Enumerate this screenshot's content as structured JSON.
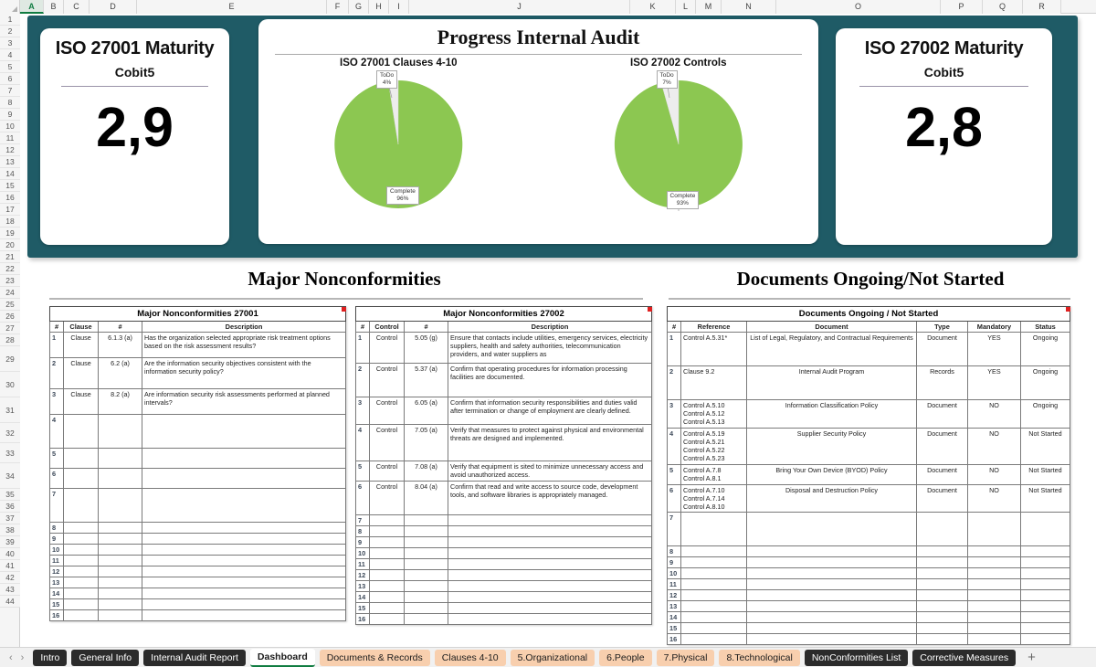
{
  "app": {
    "column_headers": [
      "A",
      "B",
      "C",
      "D",
      "E",
      "F",
      "G",
      "H",
      "I",
      "J",
      "K",
      "L",
      "M",
      "N",
      "O",
      "P",
      "Q",
      "R"
    ],
    "selected_column": "A",
    "row_numbers": [
      1,
      2,
      3,
      4,
      5,
      6,
      7,
      8,
      9,
      10,
      11,
      12,
      13,
      14,
      15,
      16,
      17,
      18,
      19,
      20,
      21,
      22,
      23,
      24,
      25,
      26,
      27,
      28,
      29,
      30,
      31,
      32,
      33,
      34,
      35,
      36,
      37,
      38,
      39,
      40,
      41,
      42,
      43,
      44
    ],
    "colors": {
      "banner_teal": "#1f5b66",
      "pie_complete_green": "#8cc751",
      "pie_todo_grey": "#ededed",
      "tab_active_underline": "#107c41",
      "tab_dark": "#2b2b2b",
      "tab_peach": "#f8cfae"
    }
  },
  "kpi_left": {
    "title": "ISO 27001 Maturity",
    "subtitle": "Cobit5",
    "value": "2,9"
  },
  "kpi_right": {
    "title": "ISO 27002 Maturity",
    "subtitle": "Cobit5",
    "value": "2,8"
  },
  "progress": {
    "title": "Progress Internal Audit"
  },
  "chart_data": [
    {
      "type": "pie",
      "title": "ISO 27001 Clauses 4-10",
      "categories": [
        "Complete",
        "ToDo"
      ],
      "values": [
        96,
        4
      ],
      "labels": [
        "Complete\n96%",
        "ToDo\n4%"
      ],
      "unit": "%",
      "colors": [
        "#8cc751",
        "#ededed"
      ],
      "legend": "none"
    },
    {
      "type": "pie",
      "title": "ISO 27002 Controls",
      "categories": [
        "Complete",
        "ToDo"
      ],
      "values": [
        93,
        7
      ],
      "labels": [
        "Complete\n93%",
        "ToDo\n7%"
      ],
      "unit": "%",
      "colors": [
        "#8cc751",
        "#ededed"
      ],
      "legend": "none"
    }
  ],
  "sections": {
    "nonconformities_heading": "Major Nonconformities",
    "documents_heading": "Documents Ongoing/Not Started"
  },
  "table_27001": {
    "title": "Major Nonconformities 27001",
    "columns": [
      "#",
      "Clause",
      "#",
      "Description"
    ],
    "rows": [
      {
        "idx": "1",
        "kind": "Clause",
        "ref": "6.1.3 (a)",
        "desc": "Has the organization selected appropriate risk treatment options based on the risk assessment results?"
      },
      {
        "idx": "2",
        "kind": "Clause",
        "ref": "6.2 (a)",
        "desc": "Are the information security objectives consistent with the information security policy?"
      },
      {
        "idx": "3",
        "kind": "Clause",
        "ref": "8.2 (a)",
        "desc": "Are information security risk assessments performed at planned intervals?"
      },
      {
        "idx": "4",
        "kind": "",
        "ref": "",
        "desc": ""
      },
      {
        "idx": "5",
        "kind": "",
        "ref": "",
        "desc": ""
      },
      {
        "idx": "6",
        "kind": "",
        "ref": "",
        "desc": ""
      },
      {
        "idx": "7",
        "kind": "",
        "ref": "",
        "desc": ""
      },
      {
        "idx": "8",
        "kind": "",
        "ref": "",
        "desc": ""
      },
      {
        "idx": "9",
        "kind": "",
        "ref": "",
        "desc": ""
      },
      {
        "idx": "10",
        "kind": "",
        "ref": "",
        "desc": ""
      },
      {
        "idx": "11",
        "kind": "",
        "ref": "",
        "desc": ""
      },
      {
        "idx": "12",
        "kind": "",
        "ref": "",
        "desc": ""
      },
      {
        "idx": "13",
        "kind": "",
        "ref": "",
        "desc": ""
      },
      {
        "idx": "14",
        "kind": "",
        "ref": "",
        "desc": ""
      },
      {
        "idx": "15",
        "kind": "",
        "ref": "",
        "desc": ""
      },
      {
        "idx": "16",
        "kind": "",
        "ref": "",
        "desc": ""
      }
    ]
  },
  "table_27002": {
    "title": "Major Nonconformities 27002",
    "columns": [
      "#",
      "Control",
      "#",
      "Description"
    ],
    "rows": [
      {
        "idx": "1",
        "kind": "Control",
        "ref": "5.05 (g)",
        "desc": "Ensure that contacts include utilities, emergency services, electricity suppliers, health and safety authorities, telecommunication providers, and water suppliers as"
      },
      {
        "idx": "2",
        "kind": "Control",
        "ref": "5.37 (a)",
        "desc": "Confirm that operating procedures for information processing facilities are documented."
      },
      {
        "idx": "3",
        "kind": "Control",
        "ref": "6.05 (a)",
        "desc": "Confirm that information security responsibilities and duties valid after termination or change of employment are clearly defined."
      },
      {
        "idx": "4",
        "kind": "Control",
        "ref": "7.05 (a)",
        "desc": "Verify that measures to protect against physical and environmental threats are designed and implemented."
      },
      {
        "idx": "5",
        "kind": "Control",
        "ref": "7.08 (a)",
        "desc": "Verify that equipment is sited to minimize unnecessary access and avoid unauthorized access."
      },
      {
        "idx": "6",
        "kind": "Control",
        "ref": "8.04 (a)",
        "desc": "Confirm that read and write access to source code, development tools, and software libraries is appropriately managed."
      },
      {
        "idx": "7",
        "kind": "",
        "ref": "",
        "desc": ""
      },
      {
        "idx": "8",
        "kind": "",
        "ref": "",
        "desc": ""
      },
      {
        "idx": "9",
        "kind": "",
        "ref": "",
        "desc": ""
      },
      {
        "idx": "10",
        "kind": "",
        "ref": "",
        "desc": ""
      },
      {
        "idx": "11",
        "kind": "",
        "ref": "",
        "desc": ""
      },
      {
        "idx": "12",
        "kind": "",
        "ref": "",
        "desc": ""
      },
      {
        "idx": "13",
        "kind": "",
        "ref": "",
        "desc": ""
      },
      {
        "idx": "14",
        "kind": "",
        "ref": "",
        "desc": ""
      },
      {
        "idx": "15",
        "kind": "",
        "ref": "",
        "desc": ""
      },
      {
        "idx": "16",
        "kind": "",
        "ref": "",
        "desc": ""
      }
    ]
  },
  "table_documents": {
    "title": "Documents Ongoing / Not Started",
    "columns": [
      "#",
      "Reference",
      "Document",
      "Type",
      "Mandatory",
      "Status"
    ],
    "rows": [
      {
        "idx": "1",
        "reference": "Control A.5.31*",
        "document": "List of Legal, Regulatory, and Contractual Requirements",
        "type": "Document",
        "mandatory": "YES",
        "status": "Ongoing"
      },
      {
        "idx": "2",
        "reference": "Clause 9.2",
        "document": "Internal Audit Program",
        "type": "Records",
        "mandatory": "YES",
        "status": "Ongoing"
      },
      {
        "idx": "3",
        "reference": "Control A.5.10\nControl A.5.12\nControl A.5.13",
        "document": "Information Classification Policy",
        "type": "Document",
        "mandatory": "NO",
        "status": "Ongoing"
      },
      {
        "idx": "4",
        "reference": "Control A.5.19\nControl A.5.21\nControl A.5.22\nControl A.5.23",
        "document": "Supplier Security Policy",
        "type": "Document",
        "mandatory": "NO",
        "status": "Not Started"
      },
      {
        "idx": "5",
        "reference": "Control A.7.8\nControl A.8.1",
        "document": "Bring Your Own Device (BYOD) Policy",
        "type": "Document",
        "mandatory": "NO",
        "status": "Not Started"
      },
      {
        "idx": "6",
        "reference": "Control A.7.10\nControl A.7.14\nControl A.8.10",
        "document": "Disposal and Destruction Policy",
        "type": "Document",
        "mandatory": "NO",
        "status": "Not Started"
      },
      {
        "idx": "7",
        "reference": "",
        "document": "",
        "type": "",
        "mandatory": "",
        "status": ""
      },
      {
        "idx": "8",
        "reference": "",
        "document": "",
        "type": "",
        "mandatory": "",
        "status": ""
      },
      {
        "idx": "9",
        "reference": "",
        "document": "",
        "type": "",
        "mandatory": "",
        "status": ""
      },
      {
        "idx": "10",
        "reference": "",
        "document": "",
        "type": "",
        "mandatory": "",
        "status": ""
      },
      {
        "idx": "11",
        "reference": "",
        "document": "",
        "type": "",
        "mandatory": "",
        "status": ""
      },
      {
        "idx": "12",
        "reference": "",
        "document": "",
        "type": "",
        "mandatory": "",
        "status": ""
      },
      {
        "idx": "13",
        "reference": "",
        "document": "",
        "type": "",
        "mandatory": "",
        "status": ""
      },
      {
        "idx": "14",
        "reference": "",
        "document": "",
        "type": "",
        "mandatory": "",
        "status": ""
      },
      {
        "idx": "15",
        "reference": "",
        "document": "",
        "type": "",
        "mandatory": "",
        "status": ""
      },
      {
        "idx": "16",
        "reference": "",
        "document": "",
        "type": "",
        "mandatory": "",
        "status": ""
      }
    ]
  },
  "tabbar": {
    "prev_label": "‹",
    "next_label": "›",
    "add_label": "+",
    "tabs": [
      {
        "label": "Intro",
        "style": "dark",
        "active": false
      },
      {
        "label": "General Info",
        "style": "dark",
        "active": false
      },
      {
        "label": "Internal Audit Report",
        "style": "dark",
        "active": false
      },
      {
        "label": "Dashboard",
        "style": "active",
        "active": true
      },
      {
        "label": "Documents & Records",
        "style": "peach",
        "active": false
      },
      {
        "label": "Clauses 4-10",
        "style": "peach",
        "active": false
      },
      {
        "label": "5.Organizational",
        "style": "peach",
        "active": false
      },
      {
        "label": "6.People",
        "style": "peach",
        "active": false
      },
      {
        "label": "7.Physical",
        "style": "peach",
        "active": false
      },
      {
        "label": "8.Technological",
        "style": "peach",
        "active": false
      },
      {
        "label": "NonConformities List",
        "style": "dark",
        "active": false
      },
      {
        "label": "Corrective Measures",
        "style": "dark",
        "active": false
      }
    ]
  }
}
